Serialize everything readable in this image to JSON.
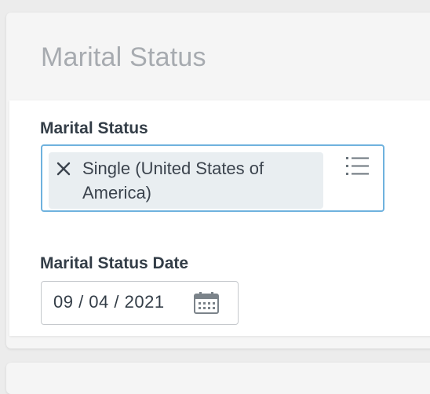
{
  "section": {
    "title": "Marital Status"
  },
  "fields": {
    "marital_status": {
      "label": "Marital Status",
      "selected_value": "Single (United States of America)",
      "remove_icon": "close-icon",
      "prompt_icon": "list-icon"
    },
    "marital_status_date": {
      "label": "Marital Status Date",
      "value": "09 / 04 / 2021",
      "icon": "calendar-icon"
    }
  },
  "colors": {
    "focus_border": "#6fb2de",
    "pill_background": "#e9eef1",
    "label_text": "#333d47",
    "section_title": "#a7abb0",
    "page_background": "#ececec"
  }
}
